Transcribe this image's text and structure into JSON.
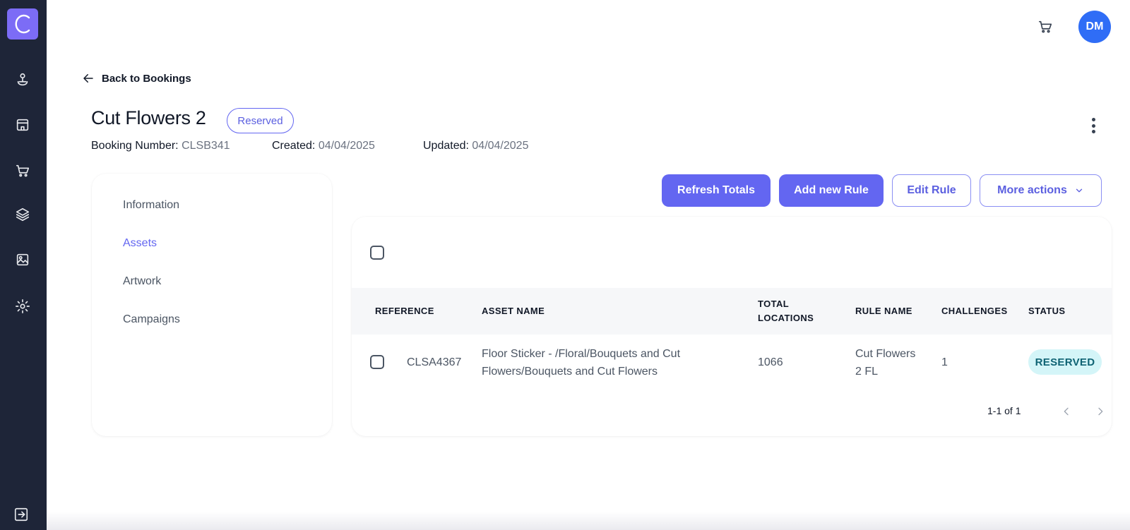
{
  "app": {
    "logo_letter": "C",
    "accent": "#6366f1",
    "sidebar_bg": "#1e2538"
  },
  "sidebar": {
    "items": [
      {
        "name": "location-icon"
      },
      {
        "name": "store-icon"
      },
      {
        "name": "cart-icon"
      },
      {
        "name": "layers-icon"
      },
      {
        "name": "image-icon"
      },
      {
        "name": "settings-icon"
      }
    ],
    "bottom_icon": "exit-icon"
  },
  "topbar": {
    "cart_icon": "cart-icon",
    "avatar_initials": "DM",
    "avatar_color": "#2f6df6"
  },
  "back_link": "Back to Bookings",
  "booking": {
    "title": "Cut Flowers 2",
    "status": "Reserved",
    "number_label": "Booking Number:",
    "number": "CLSB341",
    "created_label": "Created:",
    "created": "04/04/2025",
    "updated_label": "Updated:",
    "updated": "04/04/2025"
  },
  "tabs": [
    {
      "label": "Information",
      "active": false
    },
    {
      "label": "Assets",
      "active": true
    },
    {
      "label": "Artwork",
      "active": false
    },
    {
      "label": "Campaigns",
      "active": false
    }
  ],
  "actions": {
    "refresh": "Refresh Totals",
    "add_rule": "Add new Rule",
    "edit_rule": "Edit Rule",
    "more": "More actions"
  },
  "table": {
    "headers": {
      "reference": "REFERENCE",
      "asset_name": "ASSET NAME",
      "total_locations_1": "TOTAL",
      "total_locations_2": "LOCATIONS",
      "rule_name": "RULE NAME",
      "challenges": "CHALLENGES",
      "status": "STATUS"
    },
    "rows": [
      {
        "reference": "CLSA4367",
        "asset_name_line1": "Floor Sticker - /Floral/Bouquets and Cut",
        "asset_name_line2": "Flowers/Bouquets and Cut Flowers",
        "total_locations": "1066",
        "rule_name_line1": "Cut Flowers",
        "rule_name_line2": "2 FL",
        "challenges": "1",
        "status": "RESERVED"
      }
    ],
    "pagination": "1-1 of 1"
  }
}
